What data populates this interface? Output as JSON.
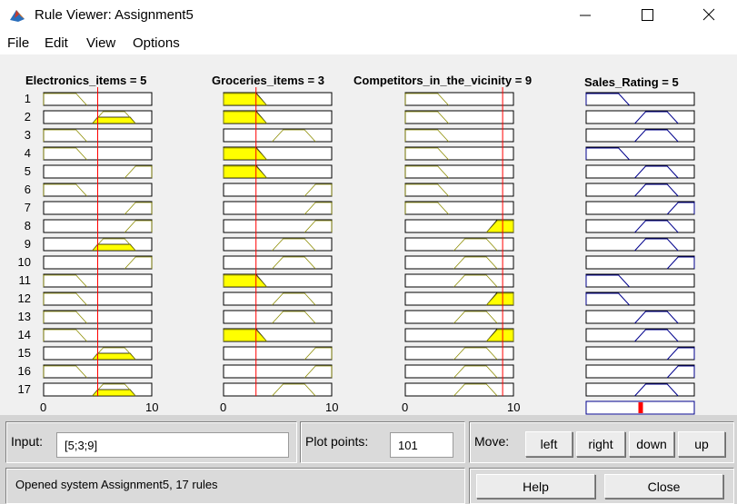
{
  "window": {
    "title": "Rule Viewer: Assignment5",
    "controls": {
      "minimize": "minimize",
      "maximize": "maximize",
      "close": "close"
    }
  },
  "menu": [
    "File",
    "Edit",
    "View",
    "Options"
  ],
  "plot": {
    "columns": [
      {
        "title": "Electronics_items = 5",
        "type": "input",
        "value": 5,
        "range": [
          0,
          10
        ],
        "tick_labels": [
          "0",
          "10"
        ]
      },
      {
        "title": "Groceries_items = 3",
        "type": "input",
        "value": 3,
        "range": [
          0,
          10
        ],
        "tick_labels": [
          "0",
          "10"
        ]
      },
      {
        "title": "Competitors_in_the_vicinity = 9",
        "type": "input",
        "value": 9,
        "range": [
          0,
          10
        ],
        "tick_labels": [
          "0",
          "10"
        ]
      },
      {
        "title": "Sales_Rating = 5",
        "type": "output",
        "value": 5,
        "range": [
          0,
          10
        ]
      }
    ],
    "rule_numbers": [
      "1",
      "2",
      "3",
      "4",
      "5",
      "6",
      "7",
      "8",
      "9",
      "10",
      "11",
      "12",
      "13",
      "14",
      "15",
      "16",
      "17"
    ],
    "membership_functions": {
      "low": [
        0,
        0,
        3,
        4
      ],
      "mid": [
        4.5,
        5.5,
        7.5,
        8.5
      ],
      "high": [
        7.5,
        8.5,
        10,
        10
      ]
    },
    "rules": [
      [
        "low",
        "low",
        "low",
        "low"
      ],
      [
        "mid",
        "low",
        "low",
        "mid"
      ],
      [
        "low",
        "mid",
        "low",
        "mid"
      ],
      [
        "low",
        "low",
        "low",
        "low"
      ],
      [
        "high",
        "low",
        "low",
        "mid"
      ],
      [
        "low",
        "high",
        "low",
        "mid"
      ],
      [
        "high",
        "high",
        "low",
        "high"
      ],
      [
        "high",
        "high",
        "high",
        "mid"
      ],
      [
        "mid",
        "mid",
        "mid",
        "mid"
      ],
      [
        "high",
        "mid",
        "mid",
        "high"
      ],
      [
        "low",
        "low",
        "mid",
        "low"
      ],
      [
        "low",
        "mid",
        "high",
        "low"
      ],
      [
        "low",
        "mid",
        "mid",
        "mid"
      ],
      [
        "low",
        "low",
        "high",
        "mid"
      ],
      [
        "mid",
        "high",
        "mid",
        "high"
      ],
      [
        "low",
        "high",
        "mid",
        "high"
      ],
      [
        "mid",
        "mid",
        "mid",
        "mid"
      ]
    ]
  },
  "input": {
    "label": "Input:",
    "value": "[5;3;9]"
  },
  "plot_points": {
    "label": "Plot points:",
    "value": "101"
  },
  "move": {
    "label": "Move:",
    "buttons": [
      "left",
      "right",
      "down",
      "up"
    ]
  },
  "status": "Opened system Assignment5, 17 rules",
  "buttons": {
    "help": "Help",
    "close": "Close"
  },
  "colors": {
    "fill": "#ffff00",
    "input_mf": "#8c8c00",
    "output_mf": "#00008c",
    "cursor": "#ff0000",
    "output_bar": "#ff0000"
  }
}
